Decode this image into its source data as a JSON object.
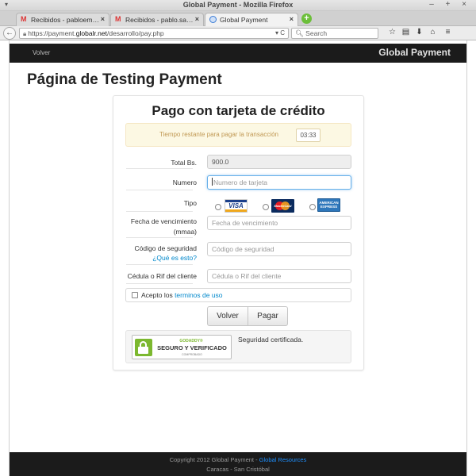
{
  "window": {
    "title": "Global Payment - Mozilla Firefox",
    "menu_glyph": "▾",
    "controls": "– + ×"
  },
  "tabs": [
    {
      "label": "Recibidos - pabloemsan...",
      "icon": "gmail-icon",
      "active": false
    },
    {
      "label": "Recibidos - pablo.sanch...",
      "icon": "gmail-icon",
      "active": false
    },
    {
      "label": "Global Payment",
      "icon": "globe-icon",
      "active": true
    }
  ],
  "tab_close_glyph": "×",
  "newtab_glyph": "+",
  "navbar": {
    "back_glyph": "←",
    "url_prefix": "https://payment.",
    "url_domain": "globalr.net",
    "url_suffix": "/desarrollo/pay.php",
    "url_tools": "▾ C",
    "search_placeholder": "Search",
    "icons": [
      "star-icon",
      "reader-icon",
      "download-icon",
      "home-icon",
      "menu-icon"
    ],
    "icon_glyphs": [
      "☆",
      "▤",
      "⬇",
      "⌂",
      "≡"
    ]
  },
  "site": {
    "back_link": "Volver",
    "brand": "Global Payment",
    "page_title": "Página de Testing Payment"
  },
  "form": {
    "title": "Pago con tarjeta de crédito",
    "timer_label": "Tiempo restante para pagar la transacción",
    "timer_value": "03:33",
    "total_label": "Total Bs.",
    "total_value": "900.0",
    "number_label": "Numero",
    "number_placeholder": "Numero de tarjeta",
    "type_label": "Tipo",
    "card_types": [
      "VISA",
      "MasterCard",
      "AMERICAN EXPRESS"
    ],
    "expiry_label_line1": "Fecha de vencimiento",
    "expiry_label_line2": "(mmaa)",
    "expiry_placeholder": "Fecha de vencimiento",
    "cvv_label": "Código de seguridad",
    "cvv_help": "¿Qué es esto?",
    "cvv_placeholder": "Código de seguridad",
    "id_label": "Cédula o Rif del cliente",
    "id_placeholder": "Cédula o Rif del cliente",
    "terms_prefix": "Acepto los ",
    "terms_link": "terminos de uso",
    "back_button": "Volver",
    "pay_button": "Pagar",
    "seal_brand": "GODADDY®",
    "seal_main": "SEGURO Y VERIFICADO",
    "seal_sub": "COMPROBADO",
    "security_text": "Seguridad certificada."
  },
  "footer": {
    "copyright": "Copyright 2012 Global Payment - ",
    "resources_link": "Global Resources",
    "location": "Caracas - San Cristóbal"
  },
  "colors": {
    "link": "#0088cc",
    "dark_bar": "#1b1b1b",
    "alert_bg": "#fcf8e3",
    "alert_text": "#c09853"
  }
}
